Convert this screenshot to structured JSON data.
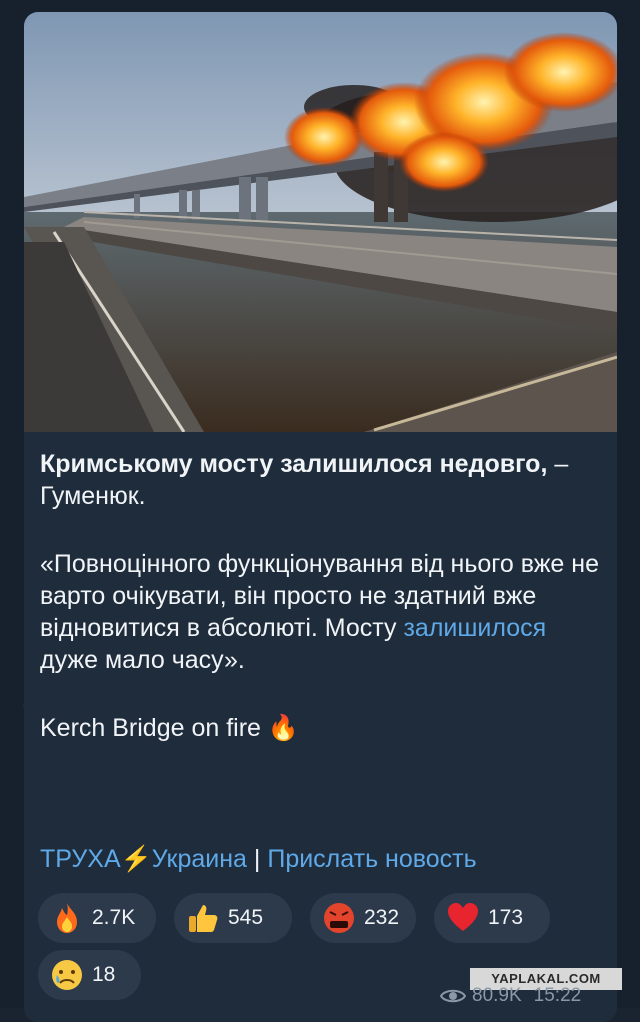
{
  "post": {
    "title_bold": "Кримському мосту залишилося недовго,",
    "title_rest": " – Гуменюк.",
    "quote_part1": "«Повноцінного функціонування від нього вже не варто очікувати, він просто не здатний вже відновитися в абсолюті. Мосту ",
    "quote_link": "залишилося",
    "quote_part2": " дуже мало часу».",
    "english_line": "Kerch Bridge on fire",
    "fire_emoji": "🔥"
  },
  "signature": {
    "channel": "ТРУХА⚡Украина",
    "separator": "|",
    "submit": "Прислать новость"
  },
  "reactions": [
    {
      "icon": "fire-icon",
      "count": "2.7K"
    },
    {
      "icon": "thumbs-up-icon",
      "count": "545"
    },
    {
      "icon": "angry-face-icon",
      "count": "232"
    },
    {
      "icon": "heart-icon",
      "count": "173"
    },
    {
      "icon": "crying-face-icon",
      "count": "18"
    }
  ],
  "meta": {
    "views": "80.9K",
    "time": "15:22"
  },
  "watermark": "YAPLAKAL.COM",
  "colors": {
    "background": "#17212e",
    "bubble": "#1f2c3b",
    "link": "#5fa9e8",
    "reaction_pill": "#2c3a4c"
  }
}
